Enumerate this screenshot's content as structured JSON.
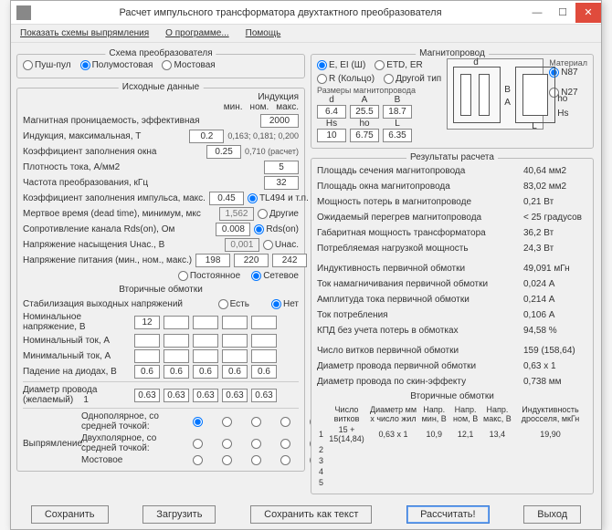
{
  "title": "Расчет импульсного трансформатора двухтактного преобразователя",
  "menu": {
    "show": "Показать схемы выпрямления",
    "about": "О программе...",
    "help": "Помощь"
  },
  "conv": {
    "title": "Схема преобразователя",
    "push": "Пуш-пул",
    "half": "Полумостовая",
    "full": "Мостовая"
  },
  "mag": {
    "title": "Магнитопровод",
    "e": "E, EI (Ш)",
    "etd": "ETD, ER",
    "r": "R (Кольцо)",
    "other": "Другой тип",
    "mat": "Материал",
    "n87": "N87",
    "n27": "N27",
    "dims": "Размеры магнитопровода",
    "d": "d",
    "a": "A",
    "b": "B",
    "hs": "Hs",
    "ho": "ho",
    "l": "L",
    "v": {
      "d": "6.4",
      "a": "25.5",
      "b": "18.7",
      "hs": "10",
      "ho": "6.75",
      "l": "6.35"
    }
  },
  "src": {
    "title": "Исходные данные",
    "ind": "Индукция",
    "min": "мин.",
    "nom": "ном.",
    "max": "макс.",
    "mu": "Магнитная проницаемость, эффективная",
    "muv": "2000",
    "bmax": "Индукция, максимальная, Т",
    "bmaxv": "0.2",
    "bmin": "0,163; 0,181; 0,200",
    "kfill": "Коэффициент заполнения окна",
    "kfillv": "0.25",
    "kfillt": "0,710 (расчет)",
    "j": "Плотность тока, А/мм2",
    "jv": "5",
    "f": "Частота преобразования, кГц",
    "fv": "32",
    "kpul": "Коэффициент заполнения импульса, макс.",
    "kpulv": "0.45",
    "tl494": "TL494 и т.п.",
    "dt": "Мертвое время (dead time), минимум, мкс",
    "dtv": "1,562",
    "dr": "Другие",
    "rds": "Сопротивление канала Rds(on), Ом",
    "rdsv": "0.008",
    "rdsb": "Rds(on)",
    "unas": "Напряжение насыщения Uнас., В",
    "unasv": "0,001",
    "unasb": "Uнас.",
    "upow": "Напряжение питания (мин., ном., макс.)",
    "upmin": "198",
    "upnom": "220",
    "upmax": "242",
    "post": "Постоянное",
    "set": "Сетевое"
  },
  "sec": {
    "title": "Вторичные обмотки",
    "stab": "Стабилизация выходных напряжений",
    "yes": "Есть",
    "no": "Нет",
    "unom": "Номинальное напряжение, В",
    "inom": "Номинальный ток, А",
    "imin": "Минимальный ток, А",
    "ud": "Падение на диодах, В",
    "v": {
      "u1": "12",
      "ud": [
        "0.6",
        "0.6",
        "0.6",
        "0.6",
        "0.6"
      ]
    },
    "dw": "Диаметр провода (желаемый)",
    "dwn": "1",
    "dwv": [
      "0.63",
      "0.63",
      "0.63",
      "0.63",
      "0.63"
    ],
    "rect": "Выпрямление:",
    "r1": "Однополярное, со средней точкой:",
    "r2": "Двухполярное, со средней точкой:",
    "r3": "Мостовое"
  },
  "res": {
    "title": "Результаты расчета",
    "r1": "Площадь сечения магнитопровода",
    "v1": "40,64 мм2",
    "r2": "Площадь окна магнитопровода",
    "v2": "83,02 мм2",
    "r3": "Мощность потерь в магнитопроводе",
    "v3": "0,21 Вт",
    "r4": "Ожидаемый перегрев магнитопровода",
    "v4": "< 25 градусов",
    "r5": "Габаритная мощность трансформатора",
    "v5": "36,2 Вт",
    "r6": "Потребляемая нагрузкой мощность",
    "v6": "24,3 Вт",
    "r7": "Индуктивность первичной обмотки",
    "v7": "49,091 мГн",
    "r8": "Ток намагничивания первичной обмотки",
    "v8": "0,024 А",
    "r9": "Амплитуда тока первичной обмотки",
    "v9": "0,214 А",
    "r10": "Ток потребления",
    "v10": "0,106 А",
    "r11": "КПД без учета потерь в обмотках",
    "v11": "94,58 %",
    "r12": "Число витков первичной обмотки",
    "v12": "159 (158,64)",
    "r13": "Диаметр провода первичной обмотки",
    "v13": "0,63 x 1",
    "r14": "Диаметр провода по скин-эффекту",
    "v14": "0,738 мм",
    "sh": "Вторичные обмотки",
    "c1": "Число витков",
    "c2": "Диаметр мм x число жил",
    "c3": "Напр. мин, В",
    "c4": "Напр. ном, В",
    "c5": "Напр. макс, В",
    "c6": "Индуктивность дросселя, мкГн",
    "rows": [
      {
        "n": "1",
        "w": "15 + 15(14,84)",
        "d": "0,63 x 1",
        "vmin": "10,9",
        "vnom": "12,1",
        "vmax": "13,4",
        "l": "19,90"
      },
      {
        "n": "2"
      },
      {
        "n": "3"
      },
      {
        "n": "4"
      },
      {
        "n": "5"
      }
    ]
  },
  "btn": {
    "save": "Сохранить",
    "load": "Загрузить",
    "savetxt": "Сохранить как текст",
    "calc": "Рассчитать!",
    "exit": "Выход"
  }
}
